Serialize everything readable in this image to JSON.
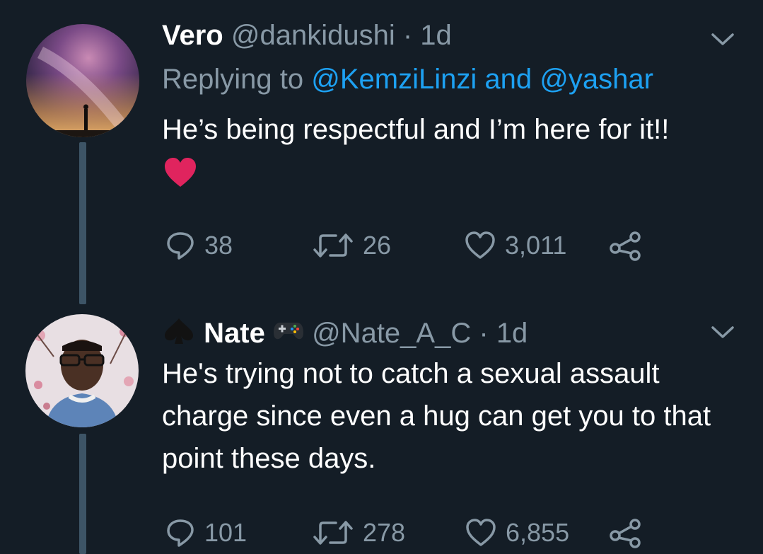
{
  "tweets": [
    {
      "name": "Vero",
      "handle": "@dankidushi",
      "sep": "·",
      "time": "1d",
      "replying_prefix": "Replying to",
      "mention1": "@KemziLinzi",
      "and": "and",
      "mention2": "@yashar",
      "text": "He’s being respectful and I’m here for it!!",
      "emoji": "red-heart",
      "replies": "38",
      "retweets": "26",
      "likes": "3,011"
    },
    {
      "name": "Nate",
      "handle": "@Nate_A_C",
      "sep": "·",
      "time": "1d",
      "text": "He's trying not to catch a sexual assault charge since even a hug can get you to that point these days.",
      "replies": "101",
      "retweets": "278",
      "likes": "6,855"
    }
  ],
  "colors": {
    "background": "#141d26",
    "muted": "#8899a6",
    "link": "#1da1f2",
    "thread_line": "#3d5466"
  }
}
